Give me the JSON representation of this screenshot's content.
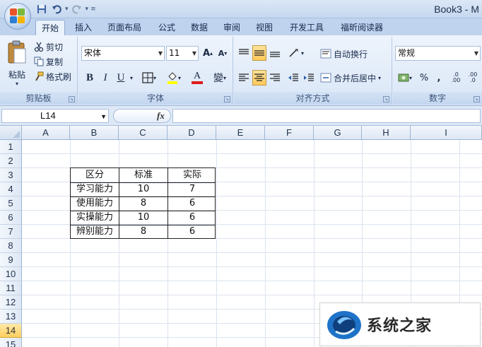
{
  "window": {
    "title": "Book3 - M"
  },
  "tabs": [
    "开始",
    "插入",
    "页面布局",
    "公式",
    "数据",
    "审阅",
    "视图",
    "开发工具",
    "福昕阅读器"
  ],
  "clipboard": {
    "paste": "粘贴",
    "cut": "剪切",
    "copy": "复制",
    "format_painter": "格式刷",
    "label": "剪贴板"
  },
  "font": {
    "name": "宋体",
    "size": "11",
    "bold": "B",
    "italic": "I",
    "underline": "U",
    "font_color": "A",
    "phonetic": "變",
    "grow": "A",
    "shrink": "A",
    "label": "字体"
  },
  "alignment": {
    "wrap": "自动换行",
    "merge": "合并后居中",
    "label": "对齐方式"
  },
  "number": {
    "format": "常规",
    "percent": "%",
    "comma": ",",
    "inc_decimal": ".0 .00",
    "dec_decimal": ".00 .0",
    "label": "数字"
  },
  "formula_bar": {
    "name_box": "L14",
    "fx": "fx",
    "formula": ""
  },
  "columns": [
    "A",
    "B",
    "C",
    "D",
    "E",
    "F",
    "G",
    "H",
    "I"
  ],
  "rows": [
    "1",
    "2",
    "3",
    "4",
    "5",
    "6",
    "7",
    "8",
    "9",
    "10",
    "11",
    "12",
    "13",
    "14",
    "15"
  ],
  "active_row": "14",
  "table": {
    "headers": [
      "区分",
      "标准",
      "实际"
    ],
    "rows": [
      [
        "学习能力",
        "10",
        "7"
      ],
      [
        "使用能力",
        "8",
        "6"
      ],
      [
        "实操能力",
        "10",
        "6"
      ],
      [
        "辨别能力",
        "8",
        "6"
      ]
    ]
  },
  "watermark": {
    "text": "系统之家"
  },
  "colors": {
    "accent": "#1e73c8",
    "highlight_yellow": "#ffff00",
    "font_red": "#e01c1c"
  }
}
